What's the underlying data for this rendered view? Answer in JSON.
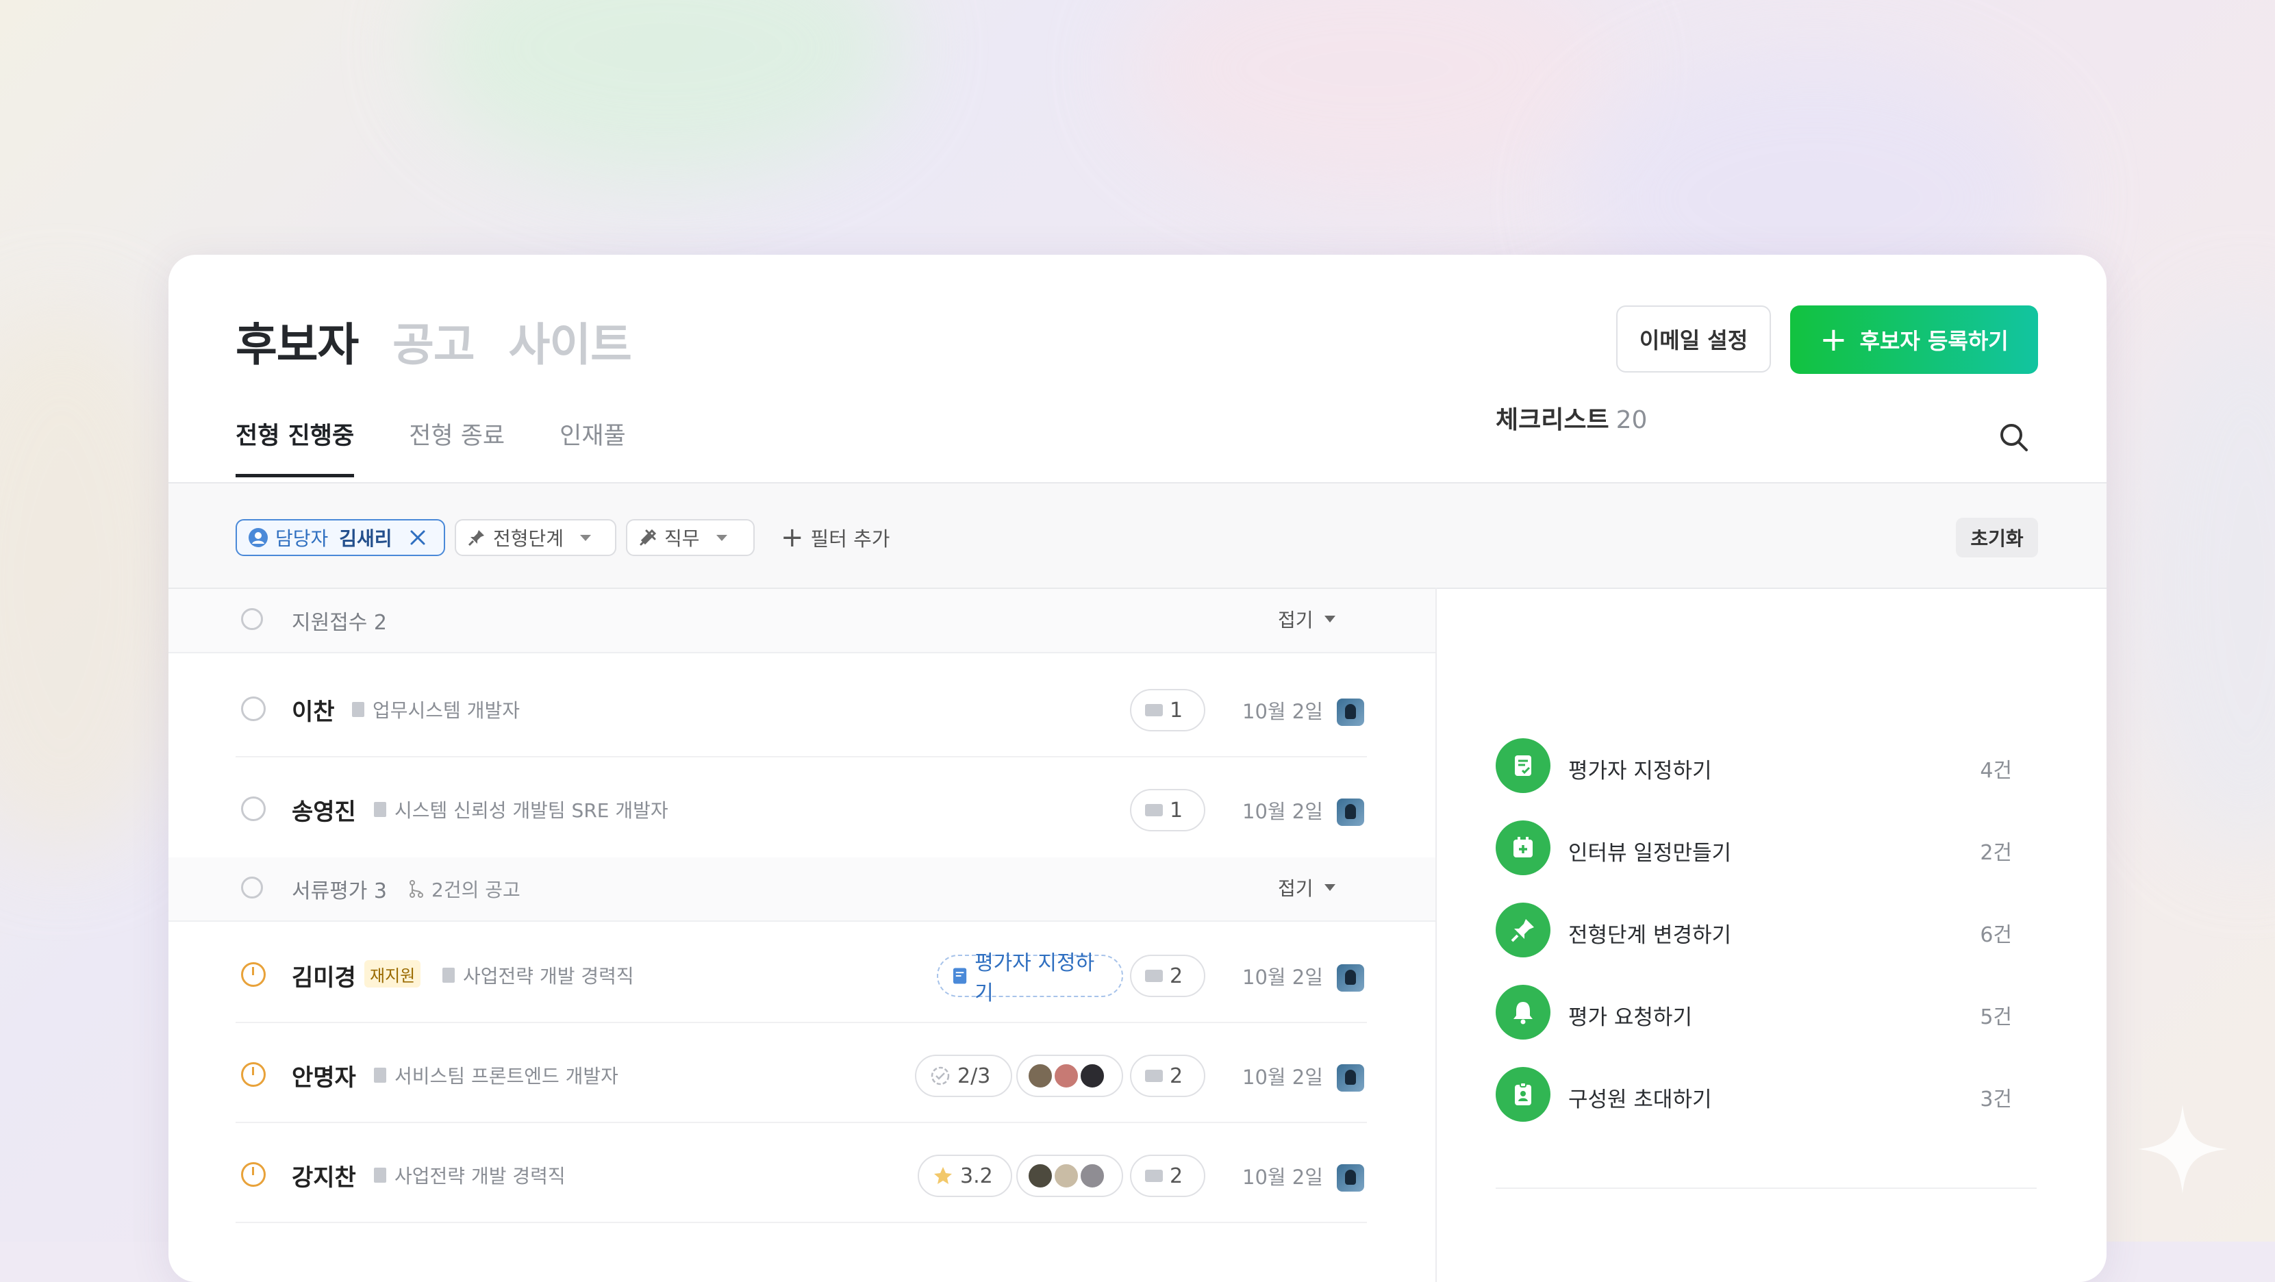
{
  "top_tabs": [
    "후보자",
    "공고",
    "사이트"
  ],
  "buttons": {
    "email_settings": "이메일 설정",
    "register": "후보자 등록하기"
  },
  "sub_tabs": [
    "전형 진행중",
    "전형 종료",
    "인재풀"
  ],
  "filters": {
    "assignee_label": "담당자",
    "assignee_value": "김새리",
    "stage": "전형단계",
    "job": "직무",
    "add": "필터 추가",
    "reset": "초기화"
  },
  "groups": [
    {
      "label": "지원접수 2",
      "fold": "접기"
    },
    {
      "label": "서류평가 3",
      "sub": "2건의 공고",
      "fold": "접기"
    }
  ],
  "candidates": [
    {
      "name": "이찬",
      "job": "업무시스템 개발자",
      "mail": "1",
      "date": "10월 2일"
    },
    {
      "name": "송영진",
      "job": "시스템 신뢰성 개발팀 SRE 개발자",
      "mail": "1",
      "date": "10월 2일"
    },
    {
      "name": "김미경",
      "badge": "재지원",
      "job": "사업전략 개발 경력직",
      "action": "평가자 지정하기",
      "mail": "2",
      "date": "10월 2일"
    },
    {
      "name": "안명자",
      "job": "서비스팀 프론트엔드 개발자",
      "progress": "2/3",
      "mail": "2",
      "date": "10월 2일"
    },
    {
      "name": "강지찬",
      "job": "사업전략 개발 경력직",
      "rating": "3.2",
      "mail": "2",
      "date": "10월 2일"
    }
  ],
  "checklist": {
    "title": "체크리스트",
    "count": "20",
    "items": [
      {
        "label": "평가자 지정하기",
        "count": "4건",
        "icon": "document-check-icon"
      },
      {
        "label": "인터뷰 일정만들기",
        "count": "2건",
        "icon": "calendar-plus-icon"
      },
      {
        "label": "전형단계 변경하기",
        "count": "6건",
        "icon": "pin-icon"
      },
      {
        "label": "평가 요청하기",
        "count": "5건",
        "icon": "bell-icon"
      },
      {
        "label": "구성원 초대하기",
        "count": "3건",
        "icon": "id-badge-icon"
      }
    ]
  },
  "colors": {
    "primary_green": "#12c23f",
    "accent_teal": "#12c4a0",
    "selected_blue": "#2f6fc0",
    "pending_orange": "#e8a23a"
  }
}
